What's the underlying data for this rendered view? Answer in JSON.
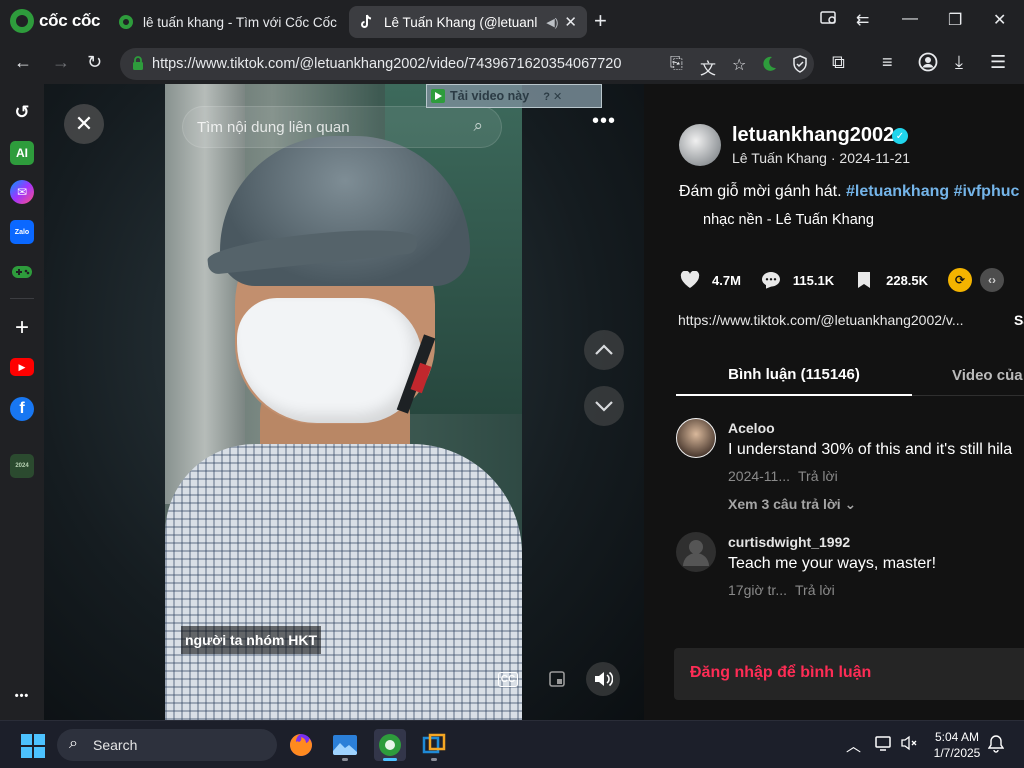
{
  "browser": {
    "brand": "cốc cốc",
    "tabs": [
      {
        "title": "lê tuấn khang - Tìm với Cốc Cốc",
        "active": false
      },
      {
        "title": "Lê Tuấn Khang (@letuanl",
        "active": true
      }
    ],
    "url": "https://www.tiktok.com/@letuankhang2002/video/7439671620354067720",
    "icons": {
      "new_tab": "+",
      "minimize": "—",
      "maximize": "❐",
      "close": "✕",
      "back": "←",
      "forward": "→",
      "reload": "↻"
    }
  },
  "sidebar": {
    "items": [
      {
        "name": "history-icon",
        "glyph": "↺",
        "color": "#202124"
      },
      {
        "name": "ai-icon",
        "glyph": "AI",
        "color": "#2e9c3c"
      },
      {
        "name": "messenger-icon",
        "glyph": "✉",
        "color": "#7b4dff"
      },
      {
        "name": "zalo-icon",
        "glyph": "Zalo",
        "color": "#0a68ff"
      },
      {
        "name": "game-icon",
        "glyph": "✚",
        "color": "#202124"
      },
      {
        "name": "add-icon",
        "glyph": "+",
        "color": "#202124"
      },
      {
        "name": "youtube-icon",
        "glyph": "▶",
        "color": "#ff0000"
      },
      {
        "name": "facebook-icon",
        "glyph": "f",
        "color": "#1877f2"
      },
      {
        "name": "coccoc-2024-icon",
        "glyph": "2024",
        "color": "#2b4a2f"
      }
    ],
    "more": "•••"
  },
  "video": {
    "search_placeholder": "Tìm nội dung liên quan",
    "download_label": "Tải video này",
    "download_extra": "? ✕",
    "caption": "người ta nhóm HKT",
    "close_glyph": "✕",
    "more_glyph": "•••",
    "up_glyph": "︿",
    "down_glyph": "﹀",
    "cc_label": "CC",
    "volume_glyph": "🔊"
  },
  "panel": {
    "handle": "letuankhang2002",
    "subtitle": "Lê Tuấn Khang · 2024-11-21",
    "description_text": "Đám giỗ mời gánh hát. ",
    "hashtags": "#letuankhang #ivfphuc",
    "music": "nhạc nền - Lê Tuấn Khang",
    "stats": {
      "likes": "4.7M",
      "comments": "115.1K",
      "saves": "228.5K"
    },
    "link": "https://www.tiktok.com/@letuankhang2002/v...",
    "copy_link": "Sa",
    "tab_comments": "Bình luận (115146)",
    "tab_videos": "Video của",
    "comments": [
      {
        "user": "Aceloo",
        "text": "I understand 30% of this and it's still hila",
        "date": "2024-11...",
        "reply": "Trả lời",
        "more": "Xem 3 câu trả lời ⌄"
      },
      {
        "user": "curtisdwight_1992",
        "text": "Teach me your ways, master!",
        "date": "17giờ tr...",
        "reply": "Trả lời"
      }
    ],
    "login_prompt": "Đăng nhập để bình luận"
  },
  "taskbar": {
    "search_label": "Search",
    "time": "5:04 AM",
    "date": "1/7/2025"
  },
  "colors": {
    "accent_red": "#fe2c55",
    "hashtag_blue": "#74b4e8",
    "coccoc_green": "#2e9c3c"
  }
}
